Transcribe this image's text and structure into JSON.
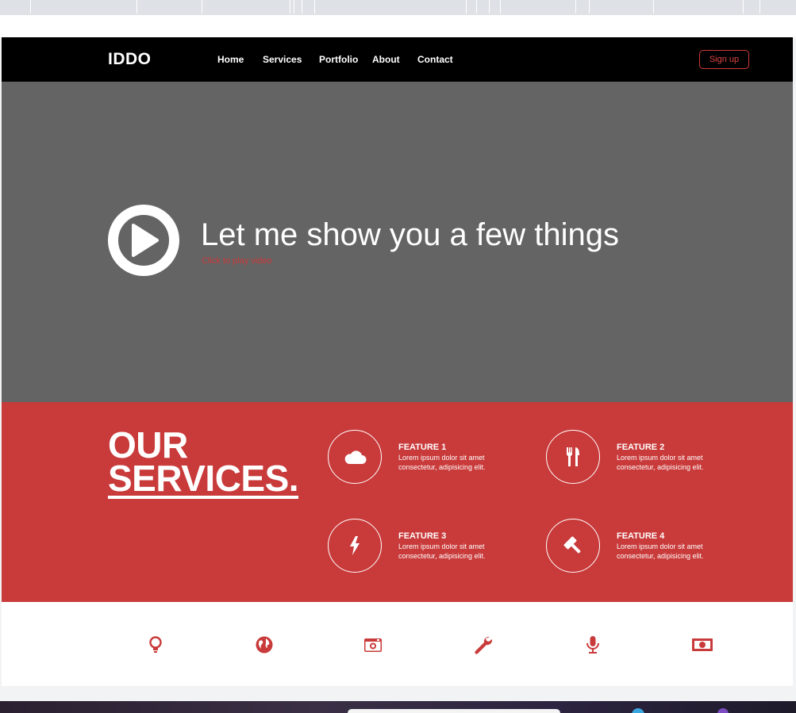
{
  "navbar": {
    "logo": "IDDO",
    "links": [
      "Home",
      "Services",
      "Portfolio",
      "About",
      "Contact"
    ],
    "signup_label": "Sign up"
  },
  "hero": {
    "title": "Let me show you a few things",
    "subtitle": "Click to play video",
    "play_icon": "play-circle-icon"
  },
  "services": {
    "title_line1": "OUR",
    "title_line2": "SERVICES.",
    "features": [
      {
        "title": "FEATURE 1",
        "desc": "Lorem ipsum dolor sit amet consectetur, adipisicing elit.",
        "icon": "cloud-icon"
      },
      {
        "title": "FEATURE 2",
        "desc": "Lorem ipsum dolor sit amet consectetur, adipisicing elit.",
        "icon": "cutlery-icon"
      },
      {
        "title": "FEATURE 3",
        "desc": "Lorem ipsum dolor sit amet consectetur, adipisicing elit.",
        "icon": "lightning-icon"
      },
      {
        "title": "FEATURE 4",
        "desc": "Lorem ipsum dolor sit amet consectetur, adipisicing elit.",
        "icon": "gavel-icon"
      }
    ]
  },
  "icon_bar": [
    "lightbulb-icon",
    "globe-icon",
    "camera-icon",
    "wrench-icon",
    "microphone-icon",
    "money-icon"
  ],
  "colors": {
    "accent": "#c93a3a",
    "navbar_bg": "#000000",
    "hero_bg": "#646464",
    "text_light": "#ffffff"
  }
}
